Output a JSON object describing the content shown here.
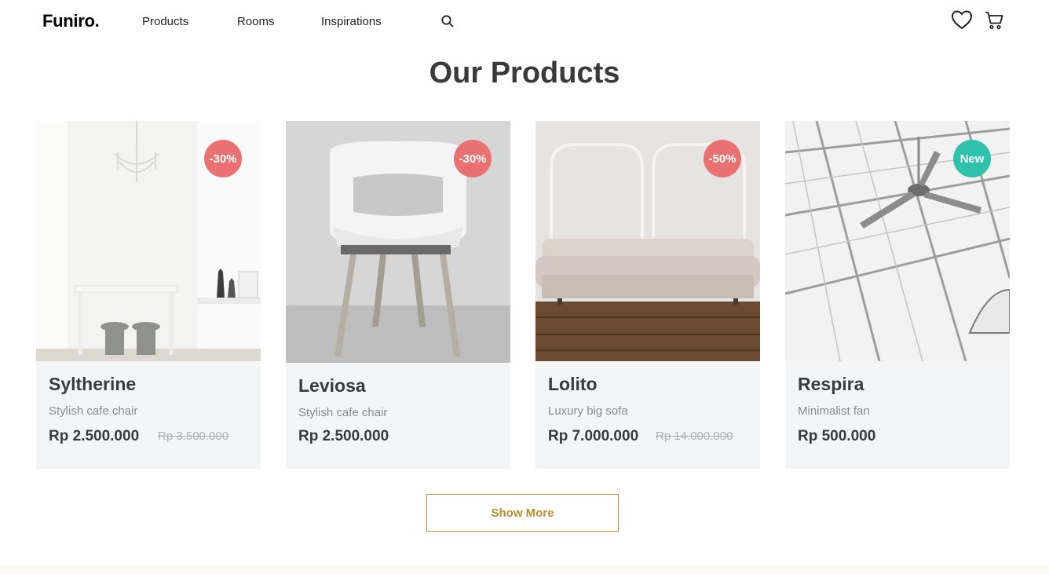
{
  "header": {
    "logo": "Funiro.",
    "nav": [
      "Products",
      "Rooms",
      "Inspirations"
    ],
    "icons": {
      "search": "search-icon",
      "favorites": "heart-icon",
      "cart": "cart-icon"
    }
  },
  "main": {
    "title": "Our Products",
    "products": [
      {
        "name": "Syltherine",
        "desc": "Stylish cafe chair",
        "price": "Rp 2.500.000",
        "old_price": "Rp 3.500.000",
        "badge": "-30%",
        "badge_type": "sale"
      },
      {
        "name": "Leviosa",
        "desc": "Stylish cafe chair",
        "price": "Rp 2.500.000",
        "old_price": "",
        "badge": "-30%",
        "badge_type": "sale"
      },
      {
        "name": "Lolito",
        "desc": "Luxury big sofa",
        "price": "Rp 7.000.000",
        "old_price": "Rp 14.000.000",
        "badge": "-50%",
        "badge_type": "sale"
      },
      {
        "name": "Respira",
        "desc": "Minimalist fan",
        "price": "Rp 500.000",
        "old_price": "",
        "badge": "New",
        "badge_type": "new"
      }
    ],
    "show_more": "Show More"
  },
  "colors": {
    "accent": "#b88e2f",
    "sale": "#e97171",
    "new": "#2ec1ac",
    "card_bg": "#f4f5f7",
    "footer_bg": "#fcf8f3"
  }
}
